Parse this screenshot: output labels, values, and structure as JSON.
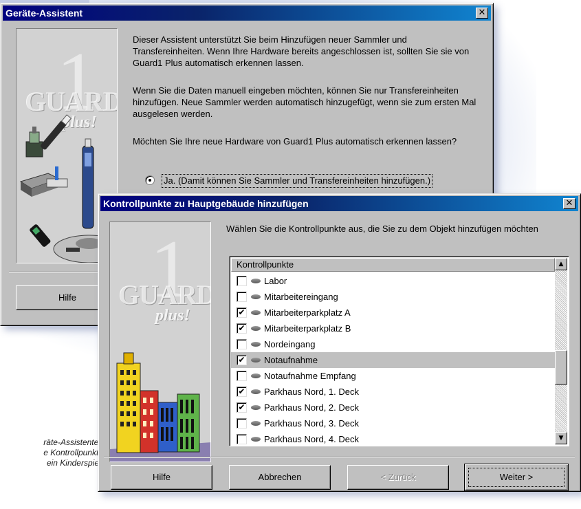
{
  "caption": {
    "lines": [
      "räte-Assistenten",
      "e Kontrollpunkte",
      "ein Kinderspiel."
    ]
  },
  "wizard": {
    "title": "Geräte-Assistent",
    "close_label": "✕",
    "paragraphs": [
      "Dieser Assistent unterstützt Sie beim Hinzufügen neuer Sammler und Transfereinheiten. Wenn Ihre Hardware bereits angeschlossen ist, sollten Sie sie von Guard1 Plus automatisch erkennen lassen.",
      "Wenn Sie die Daten manuell eingeben möchten, können Sie nur Transfereinheiten hinzufügen. Neue Sammler werden automatisch hinzugefügt, wenn sie zum ersten Mal ausgelesen werden.",
      "Möchten Sie Ihre neue Hardware von Guard1 Plus automatisch erkennen lassen?"
    ],
    "radio_label": "Ja. (Damit können Sie Sammler und Transfereinheiten hinzufügen.)",
    "help_button": "Hilfe",
    "logo": {
      "guard": "GUARD",
      "plus": "plus!",
      "one": "1"
    }
  },
  "dialog": {
    "title": "Kontrollpunkte zu Hauptgebäude hinzufügen",
    "close_label": "✕",
    "instruction": "Wählen Sie die Kontrollpunkte aus, die Sie zu dem Objekt hinzufügen möchten",
    "list_header": "Kontrollpunkte",
    "items": [
      {
        "label": "Labor",
        "checked": false
      },
      {
        "label": "Mitarbeitereingang",
        "checked": false
      },
      {
        "label": "Mitarbeiterparkplatz A",
        "checked": true
      },
      {
        "label": "Mitarbeiterparkplatz B",
        "checked": true
      },
      {
        "label": "Nordeingang",
        "checked": false
      },
      {
        "label": "Notaufnahme",
        "checked": true,
        "selected": true
      },
      {
        "label": "Notaufnahme Empfang",
        "checked": false
      },
      {
        "label": "Parkhaus Nord, 1. Deck",
        "checked": true
      },
      {
        "label": "Parkhaus Nord, 2. Deck",
        "checked": true
      },
      {
        "label": "Parkhaus Nord, 3. Deck",
        "checked": false
      },
      {
        "label": "Parkhaus Nord, 4. Deck",
        "checked": false
      }
    ],
    "scroll_up": "▲",
    "scroll_down": "▼",
    "buttons": {
      "help": "Hilfe",
      "cancel": "Abbrechen",
      "back": "< Zurück",
      "next": "Weiter >"
    },
    "logo": {
      "guard": "GUARD",
      "plus": "plus!",
      "one": "1"
    }
  }
}
